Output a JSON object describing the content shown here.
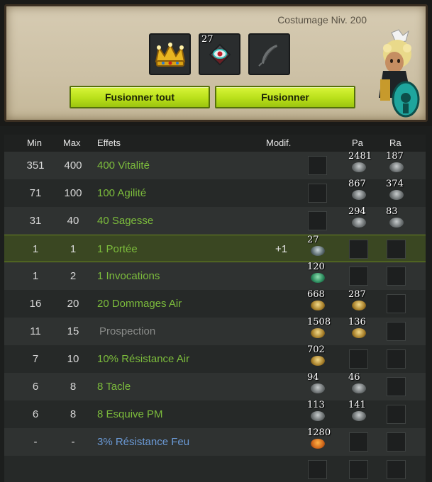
{
  "header": {
    "level_label": "Costumage Niv. 200",
    "slot_count": "27"
  },
  "buttons": {
    "fuse_all": "Fusionner tout",
    "fuse": "Fusionner"
  },
  "columns": {
    "min": "Min",
    "max": "Max",
    "effects": "Effets",
    "modif": "Modif.",
    "pa": "Pa",
    "ra": "Ra"
  },
  "rows": [
    {
      "min": "351",
      "max": "400",
      "effect": "400 Vitalité",
      "modif": "",
      "ba": "",
      "pa": "2481",
      "ra": "187"
    },
    {
      "min": "71",
      "max": "100",
      "effect": "100 Agilité",
      "modif": "",
      "ba": "",
      "pa": "867",
      "ra": "374"
    },
    {
      "min": "31",
      "max": "40",
      "effect": "40 Sagesse",
      "modif": "",
      "ba": "",
      "pa": "294",
      "ra": "83"
    },
    {
      "min": "1",
      "max": "1",
      "effect": "1 Portée",
      "modif": "+1",
      "ba": "27",
      "pa": "",
      "ra": ""
    },
    {
      "min": "1",
      "max": "2",
      "effect": "1 Invocations",
      "modif": "",
      "ba": "120",
      "pa": "",
      "ra": ""
    },
    {
      "min": "16",
      "max": "20",
      "effect": "20 Dommages Air",
      "modif": "",
      "ba": "668",
      "pa": "287",
      "ra": ""
    },
    {
      "min": "11",
      "max": "15",
      "effect": "Prospection",
      "modif": "",
      "ba": "1508",
      "pa": "136",
      "ra": ""
    },
    {
      "min": "7",
      "max": "10",
      "effect": "10% Résistance Air",
      "modif": "",
      "ba": "702",
      "pa": "",
      "ra": ""
    },
    {
      "min": "6",
      "max": "8",
      "effect": "8 Tacle",
      "modif": "",
      "ba": "94",
      "pa": "46",
      "ra": ""
    },
    {
      "min": "6",
      "max": "8",
      "effect": "8 Esquive PM",
      "modif": "",
      "ba": "113",
      "pa": "141",
      "ra": ""
    },
    {
      "min": "-",
      "max": "-",
      "effect": "3% Résistance Feu",
      "modif": "",
      "ba": "1280",
      "pa": "",
      "ra": ""
    }
  ],
  "colors": {
    "effect_green": "#7cbc3c",
    "effect_blue": "#6b9ad6",
    "effect_grey": "#8a8c8a",
    "button_green": "#b9e01a"
  }
}
